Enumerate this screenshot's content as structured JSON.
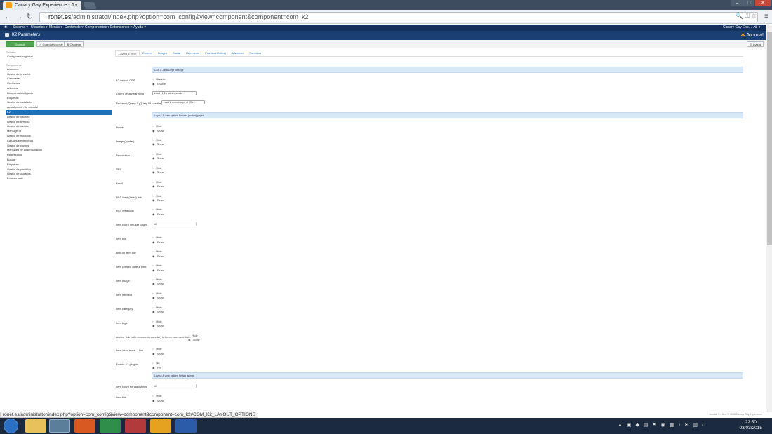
{
  "browser": {
    "tab_title": "Canary Gay Experience - J",
    "url_host": "ronet.es",
    "url_path": "/administrator/index.php?option=com_config&view=component&component=com_k2",
    "status_url": "ronet.es/administrator/index.php?option=com_config&view=component&component=com_k2#COM_K2_LAYOUT_OPTIONS"
  },
  "adminnav": {
    "items": [
      "Sistema ▾",
      "Usuarios ▾",
      "Menús ▾",
      "Contenido ▾",
      "Componentes ▾",
      "Extensiones ▾",
      "Ayuda ▾"
    ],
    "site_name": "Canary Gay Exp... ↗",
    "user_icon": "⚙ ▾"
  },
  "subheader": {
    "title": "K2 Parameters",
    "logo_text": "Joomla!"
  },
  "actions": {
    "save": "Guardar",
    "save_close": "✓ Guardar y cerrar",
    "cancel": "⊗ Cancelar",
    "help": "⊙ Ayuda"
  },
  "sidebar": {
    "system_title": "Sistema",
    "system_items": [
      "Configuración global"
    ],
    "component_title": "Componente",
    "items": [
      "Anuncios",
      "Gestor de la caché",
      "Cabeceras",
      "Contactos",
      "Artículos",
      "Búsqueda inteligente",
      "Etiquetas",
      "Gestor de instalador",
      "Actualización de Joomla!",
      "K2",
      "Gestor de idiomas",
      "Gestor multimedia",
      "Gestor de menús",
      "Mensajería",
      "Gestor de módulos",
      "Canales electrónicos",
      "Gestor de plugins",
      "Mensajes de postinstalación",
      "Redirección",
      "Buscar",
      "Etiquetas",
      "Gestor de plantillas",
      "Gestor de usuarios",
      "Enlaces web"
    ],
    "active_index": 9
  },
  "tabs": [
    "Layout & view",
    "Content",
    "Images",
    "Social",
    "Comments",
    "Frontend Editing",
    "Advanced",
    "Permisos"
  ],
  "bands": {
    "css": "CSS & JavaScript Settings",
    "user": "Layout & view options for user (author) pages",
    "tag": "Layout & view options for tag listings"
  },
  "css": {
    "k2_css_label": "K2 default CSS",
    "k2_css_opts": [
      "Disable",
      "Enable"
    ],
    "jquery_label": "jQuery library handling",
    "jquery_value": "Load v1.8.x latest (remote ...",
    "backend_label": "Backend jQuery & jQuery UI handling",
    "backend_value": "Load & remote copy of (Go..."
  },
  "user_fields": [
    {
      "label": "Name",
      "opts": [
        "Hide",
        "Show"
      ]
    },
    {
      "label": "Image (avatar)",
      "opts": [
        "Hide",
        "Show"
      ]
    },
    {
      "label": "Description",
      "opts": [
        "Hide",
        "Show"
      ]
    },
    {
      "label": "URL",
      "opts": [
        "Hide",
        "Show"
      ]
    },
    {
      "label": "Email",
      "opts": [
        "Hide",
        "Show"
      ]
    },
    {
      "label": "RSS feed (head) link",
      "opts": [
        "Hide",
        "Show"
      ]
    },
    {
      "label": "RSS feed icon",
      "opts": [
        "Hide",
        "Show"
      ]
    },
    {
      "label": "Item count on user pages",
      "input": "10"
    },
    {
      "label": "Item title",
      "opts": [
        "Hide",
        "Show"
      ]
    },
    {
      "label": "Link on item title",
      "opts": [
        "Hide",
        "Show"
      ]
    },
    {
      "label": "Item created date & time",
      "opts": [
        "Hide",
        "Show"
      ]
    },
    {
      "label": "Item image",
      "opts": [
        "Hide",
        "Show"
      ]
    },
    {
      "label": "Item introtext",
      "opts": [
        "Hide",
        "Show"
      ]
    },
    {
      "label": "Item category",
      "opts": [
        "Hide",
        "Show"
      ]
    },
    {
      "label": "Item tags",
      "opts": [
        "Hide",
        "Show"
      ]
    },
    {
      "label": "Anchor link (with comments counter) to items comment form",
      "opts": [
        "Hide",
        "Show"
      ]
    },
    {
      "label": "Item 'read more...' link",
      "opts": [
        "Hide",
        "Show"
      ]
    },
    {
      "label": "Enable K2 plugins",
      "opts": [
        "No",
        "Yes"
      ]
    }
  ],
  "tag_fields": [
    {
      "label": "Item count for tag listings",
      "input": "10"
    },
    {
      "label": "Item title",
      "opts": [
        "Hide",
        "Show"
      ]
    }
  ],
  "footer_right": "Joomla! 3.3.6 — © 2015 Canary Gay Experience",
  "clock": {
    "time": "22:50",
    "date": "03/03/2015"
  }
}
